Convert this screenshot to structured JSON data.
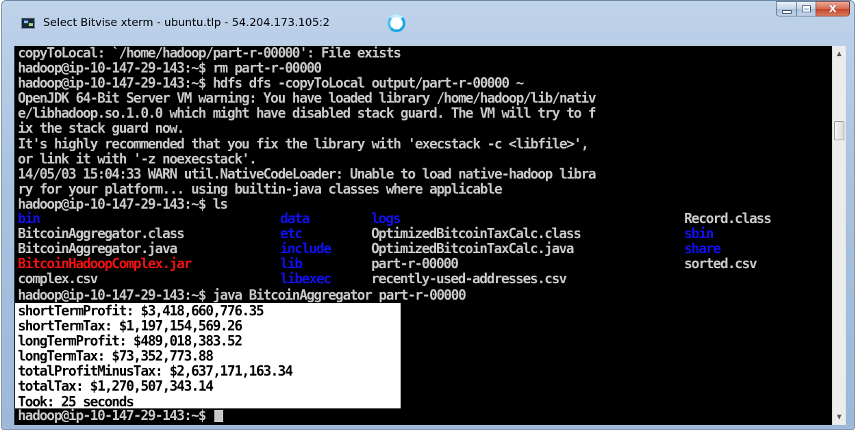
{
  "window": {
    "title": "Select Bitvise xterm - ubuntu.tlp - 54.204.173.105:2",
    "icon": "terminal-app-icon",
    "controls": {
      "minimize": "minimize-icon",
      "maximize": "maximize-icon",
      "close": "X"
    }
  },
  "terminal": {
    "top_lines": [
      "copyToLocal: `/home/hadoop/part-r-00000': File exists",
      "hadoop@ip-10-147-29-143:~$ rm part-r-00000",
      "hadoop@ip-10-147-29-143:~$ hdfs dfs -copyToLocal output/part-r-00000 ~",
      "OpenJDK 64-Bit Server VM warning: You have loaded library /home/hadoop/lib/nativ",
      "e/libhadoop.so.1.0.0 which might have disabled stack guard. The VM will try to f",
      "ix the stack guard now.",
      "It's highly recommended that you fix the library with 'execstack -c <libfile>',",
      "or link it with '-z noexecstack'.",
      "14/05/03 15:04:33 WARN util.NativeCodeLoader: Unable to load native-hadoop libra",
      "ry for your platform... using builtin-java classes where applicable",
      "hadoop@ip-10-147-29-143:~$ ls"
    ],
    "ls": {
      "col1": [
        {
          "text": "bin",
          "color": "blue"
        },
        {
          "text": "BitcoinAggregator.class",
          "color": "default"
        },
        {
          "text": "BitcoinAggregator.java",
          "color": "default"
        },
        {
          "text": "BitcoinHadoopComplex.jar",
          "color": "red"
        },
        {
          "text": "complex.csv",
          "color": "default"
        }
      ],
      "col2": [
        {
          "text": "data",
          "color": "blue"
        },
        {
          "text": "etc",
          "color": "blue"
        },
        {
          "text": "include",
          "color": "blue"
        },
        {
          "text": "lib",
          "color": "blue"
        },
        {
          "text": "libexec",
          "color": "blue"
        }
      ],
      "col3": [
        {
          "text": "logs",
          "color": "blue"
        },
        {
          "text": "OptimizedBitcoinTaxCalc.class",
          "color": "default"
        },
        {
          "text": "OptimizedBitcoinTaxCalc.java",
          "color": "default"
        },
        {
          "text": "part-r-00000",
          "color": "default"
        },
        {
          "text": "recently-used-addresses.csv",
          "color": "default"
        }
      ],
      "col4": [
        {
          "text": "Record.class",
          "color": "default"
        },
        {
          "text": "sbin",
          "color": "blue"
        },
        {
          "text": "share",
          "color": "blue"
        },
        {
          "text": "sorted.csv",
          "color": "default"
        },
        {
          "text": "",
          "color": "default"
        }
      ]
    },
    "run_command": "hadoop@ip-10-147-29-143:~$ java BitcoinAggregator part-r-00000",
    "output": [
      "shortTermProfit: $3,418,660,776.35",
      "shortTermTax: $1,197,154,569.26",
      "longTermProfit: $489,018,383.52",
      "longTermTax: $73,352,773.88",
      "totalProfitMinusTax: $2,637,171,163.34",
      "totalTax: $1,270,507,343.14",
      "Took: 25 seconds"
    ],
    "final_prompt": "hadoop@ip-10-147-29-143:~$ "
  },
  "colors": {
    "terminal_bg": "#000000",
    "text": "#c8c8c8",
    "dir": "#1010ee",
    "archive": "#ee1010",
    "selection_bg": "#ffffff"
  }
}
